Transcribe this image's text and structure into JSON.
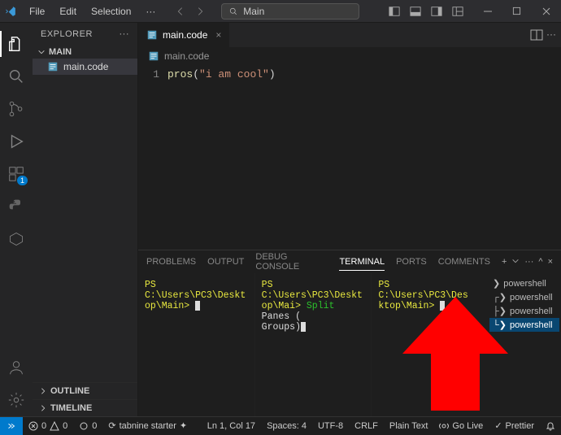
{
  "titlebar": {
    "menus": [
      "File",
      "Edit",
      "Selection",
      "···"
    ],
    "search_label": "Main"
  },
  "explorer": {
    "title": "EXPLORER",
    "project": "MAIN",
    "file": "main.code",
    "outline": "OUTLINE",
    "timeline": "TIMELINE"
  },
  "activity": {
    "ext_badge": "1"
  },
  "editor": {
    "tab": "main.code",
    "breadcrumb": "main.code",
    "line_no": "1",
    "code_fn": "pros",
    "code_open": "(",
    "code_str": "\"i am cool\"",
    "code_close": ")"
  },
  "panel": {
    "tabs": [
      "PROBLEMS",
      "OUTPUT",
      "DEBUG CONSOLE",
      "TERMINAL",
      "PORTS",
      "COMMENTS"
    ],
    "term1_a": "PS C:\\Users\\PC3\\Deskt",
    "term1_b": "op\\Main> ",
    "term2_a": "PS C:\\Users\\PC3\\Deskt",
    "term2_b": "op\\Mai> ",
    "term2_cmd1": "Split",
    "term2_cmd2": " Panes (",
    "term2_c": "Groups)",
    "term3_a": "PS C:\\Users\\PC3\\Des",
    "term3_b": "ktop\\Main> ",
    "shells": [
      "powershell",
      "powershell",
      "powershell",
      "powershell"
    ]
  },
  "status": {
    "errors": "0",
    "warnings": "0",
    "ports": "0",
    "tabnine": "tabnine starter",
    "lncol": "Ln 1, Col 17",
    "spaces": "Spaces: 4",
    "encoding": "UTF-8",
    "eol": "CRLF",
    "lang": "Plain Text",
    "golive": "Go Live",
    "prettier": "Prettier"
  }
}
